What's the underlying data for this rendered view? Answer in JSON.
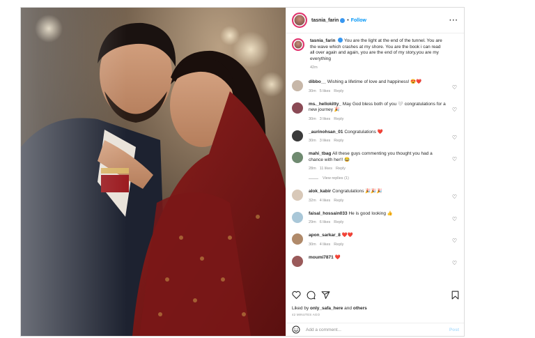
{
  "post": {
    "username": "tasnia_farin",
    "follow_label": "Follow",
    "separator": "•",
    "more_label": "···",
    "caption": "You are the light at the end of the tunnel. You are the wave which crashes at my shore. You are the book i can read all over again and again, you are the end of my story,you are my everything",
    "caption_time": "42m"
  },
  "comments": [
    {
      "user": "dibbo__",
      "text": "Wishing a lifetime of love and happiness! 😍❤️",
      "time": "30m",
      "likes": "5 likes",
      "reply": "Reply"
    },
    {
      "user": "ms._hellokitty_",
      "text": "May God bless both of you 🤍 congratulations for a new journey 🎉",
      "time": "30m",
      "likes": "3 likes",
      "reply": "Reply"
    },
    {
      "user": "_aurinohsan_01",
      "text": "Congratulations ❤️",
      "time": "30m",
      "likes": "3 likes",
      "reply": "Reply"
    },
    {
      "user": "mahi_tbag",
      "text": "All these guys commenting you thought you had a chance with her!! 😂",
      "time": "28m",
      "likes": "11 likes",
      "reply": "Reply",
      "view_replies": "View replies (1)"
    },
    {
      "user": "alok_kabir",
      "text": "Congratulations 🎉🎉🎉",
      "time": "32m",
      "likes": "4 likes",
      "reply": "Reply"
    },
    {
      "user": "faisal_hossain033",
      "text": "He is good looking 👍",
      "time": "29m",
      "likes": "6 likes",
      "reply": "Reply"
    },
    {
      "user": "apon_sarkar_8",
      "text": "❤️❤️",
      "time": "30m",
      "likes": "4 likes",
      "reply": "Reply"
    },
    {
      "user": "moumi7871",
      "text": "❤️",
      "time": "",
      "likes": "",
      "reply": ""
    }
  ],
  "footer": {
    "liked_prefix": "Liked by ",
    "liked_user": "only_safa_here",
    "liked_mid": " and ",
    "liked_others": "others",
    "ago": "42 MINUTES AGO",
    "add_comment_placeholder": "Add a comment...",
    "post_label": "Post"
  },
  "icons": {
    "like": "heart-icon",
    "comment": "comment-icon",
    "share": "paper-plane-icon",
    "save": "bookmark-icon",
    "emoji": "smiley-icon"
  },
  "colors": {
    "link_blue": "#0095f6",
    "post_disabled": "#b2dffc",
    "story_ring": "#e1306c"
  }
}
